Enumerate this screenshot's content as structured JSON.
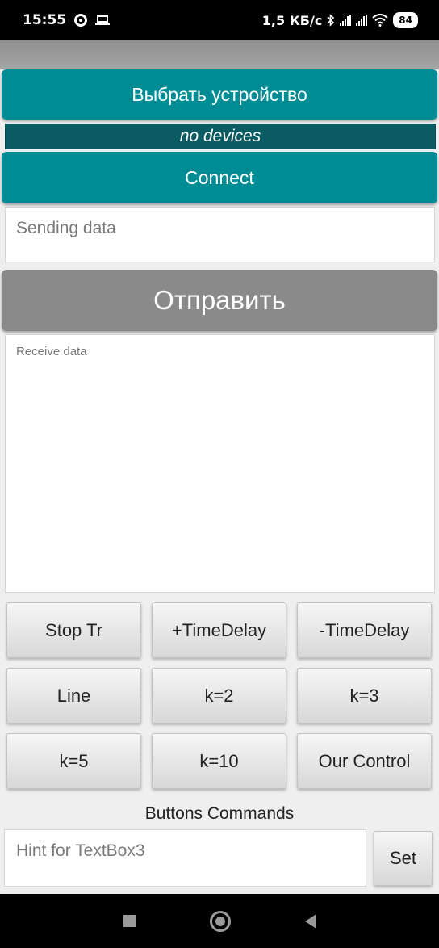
{
  "status_bar": {
    "time": "15:55",
    "speed": "1,5 КБ/с",
    "battery": "84"
  },
  "device_section": {
    "select_button_label": "Выбрать устройство",
    "device_status": "no devices",
    "connect_button_label": "Connect"
  },
  "send_section": {
    "input_placeholder": "Sending data",
    "send_button_label": "Отправить"
  },
  "receive_section": {
    "placeholder": "Receive data"
  },
  "command_buttons": [
    "Stop Tr",
    "+TimeDelay",
    "-TimeDelay",
    "Line",
    "k=2",
    "k=3",
    "k=5",
    "k=10",
    "Our Control"
  ],
  "commands_section": {
    "label": "Buttons Commands",
    "hint_placeholder": "Hint for TextBox3",
    "set_button_label": "Set"
  },
  "icons": {
    "status_left": [
      "sync-icon",
      "laptop-icon"
    ],
    "status_right": [
      "bluetooth-icon",
      "signal-icon",
      "signal-icon",
      "wifi-icon",
      "battery-icon"
    ],
    "nav": [
      "recent-apps-icon",
      "home-icon",
      "back-icon"
    ]
  },
  "colors": {
    "accent_teal": "#008c95",
    "device_status_bg": "#0a5b62",
    "send_button_bg": "#8a8a8a"
  }
}
